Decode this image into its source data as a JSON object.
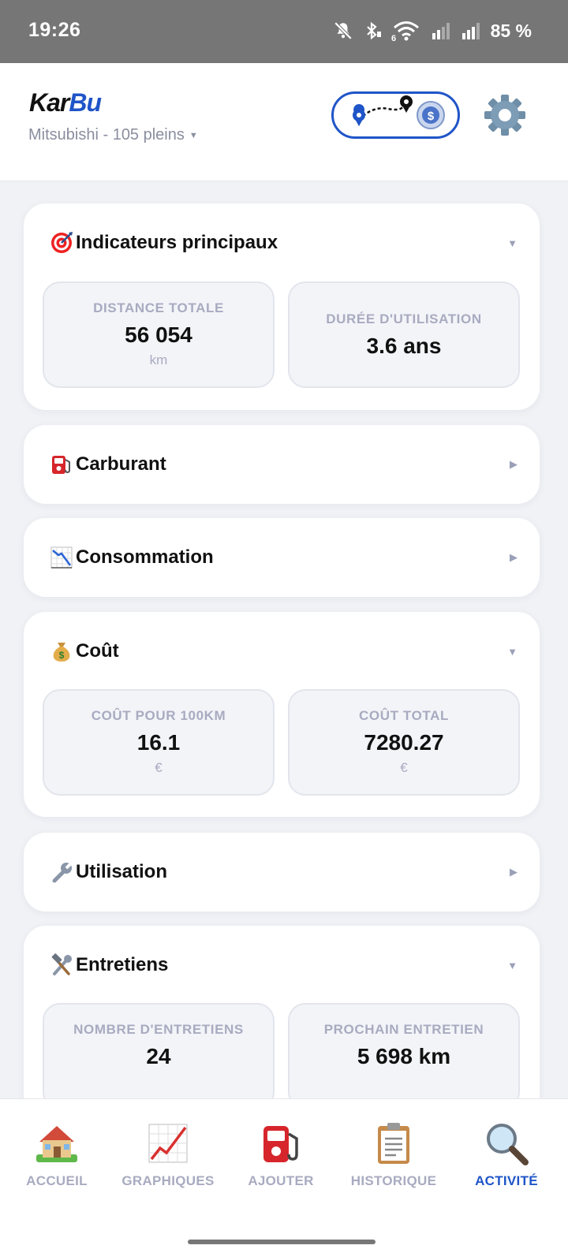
{
  "status_bar": {
    "time": "19:26",
    "battery": "85 %",
    "network_type": "6"
  },
  "header": {
    "logo_primary": "Kar",
    "logo_accent": "Bu",
    "vehicle_summary": "Mitsubishi - 105 pleins"
  },
  "sections": {
    "indicateurs": {
      "title": "Indicateurs principaux",
      "distance_label": "DISTANCE TOTALE",
      "distance_value": "56 054",
      "distance_unit": "km",
      "duree_label": "DURÉE D'UTILISATION",
      "duree_value": "3.6 ans"
    },
    "carburant": {
      "title": "Carburant"
    },
    "consommation": {
      "title": "Consommation"
    },
    "cout": {
      "title": "Coût",
      "cout100_label": "COÛT POUR 100KM",
      "cout100_value": "16.1",
      "cout100_unit": "€",
      "total_label": "COÛT TOTAL",
      "total_value": "7280.27",
      "total_unit": "€"
    },
    "utilisation": {
      "title": "Utilisation"
    },
    "entretiens": {
      "title": "Entretiens",
      "nombre_label": "NOMBRE D'ENTRETIENS",
      "nombre_value": "24",
      "prochain_label": "PROCHAIN ENTRETIEN",
      "prochain_value": "5 698 km"
    }
  },
  "tabs": [
    {
      "label": "ACCUEIL",
      "icon": "house-icon"
    },
    {
      "label": "GRAPHIQUES",
      "icon": "chart-icon"
    },
    {
      "label": "AJOUTER",
      "icon": "fuel-pump-icon"
    },
    {
      "label": "HISTORIQUE",
      "icon": "clipboard-icon"
    },
    {
      "label": "ACTIVITÉ",
      "icon": "magnifier-icon"
    }
  ],
  "colors": {
    "accent": "#1f55c8",
    "muted": "#a8abc0",
    "background": "#f1f2f6"
  }
}
